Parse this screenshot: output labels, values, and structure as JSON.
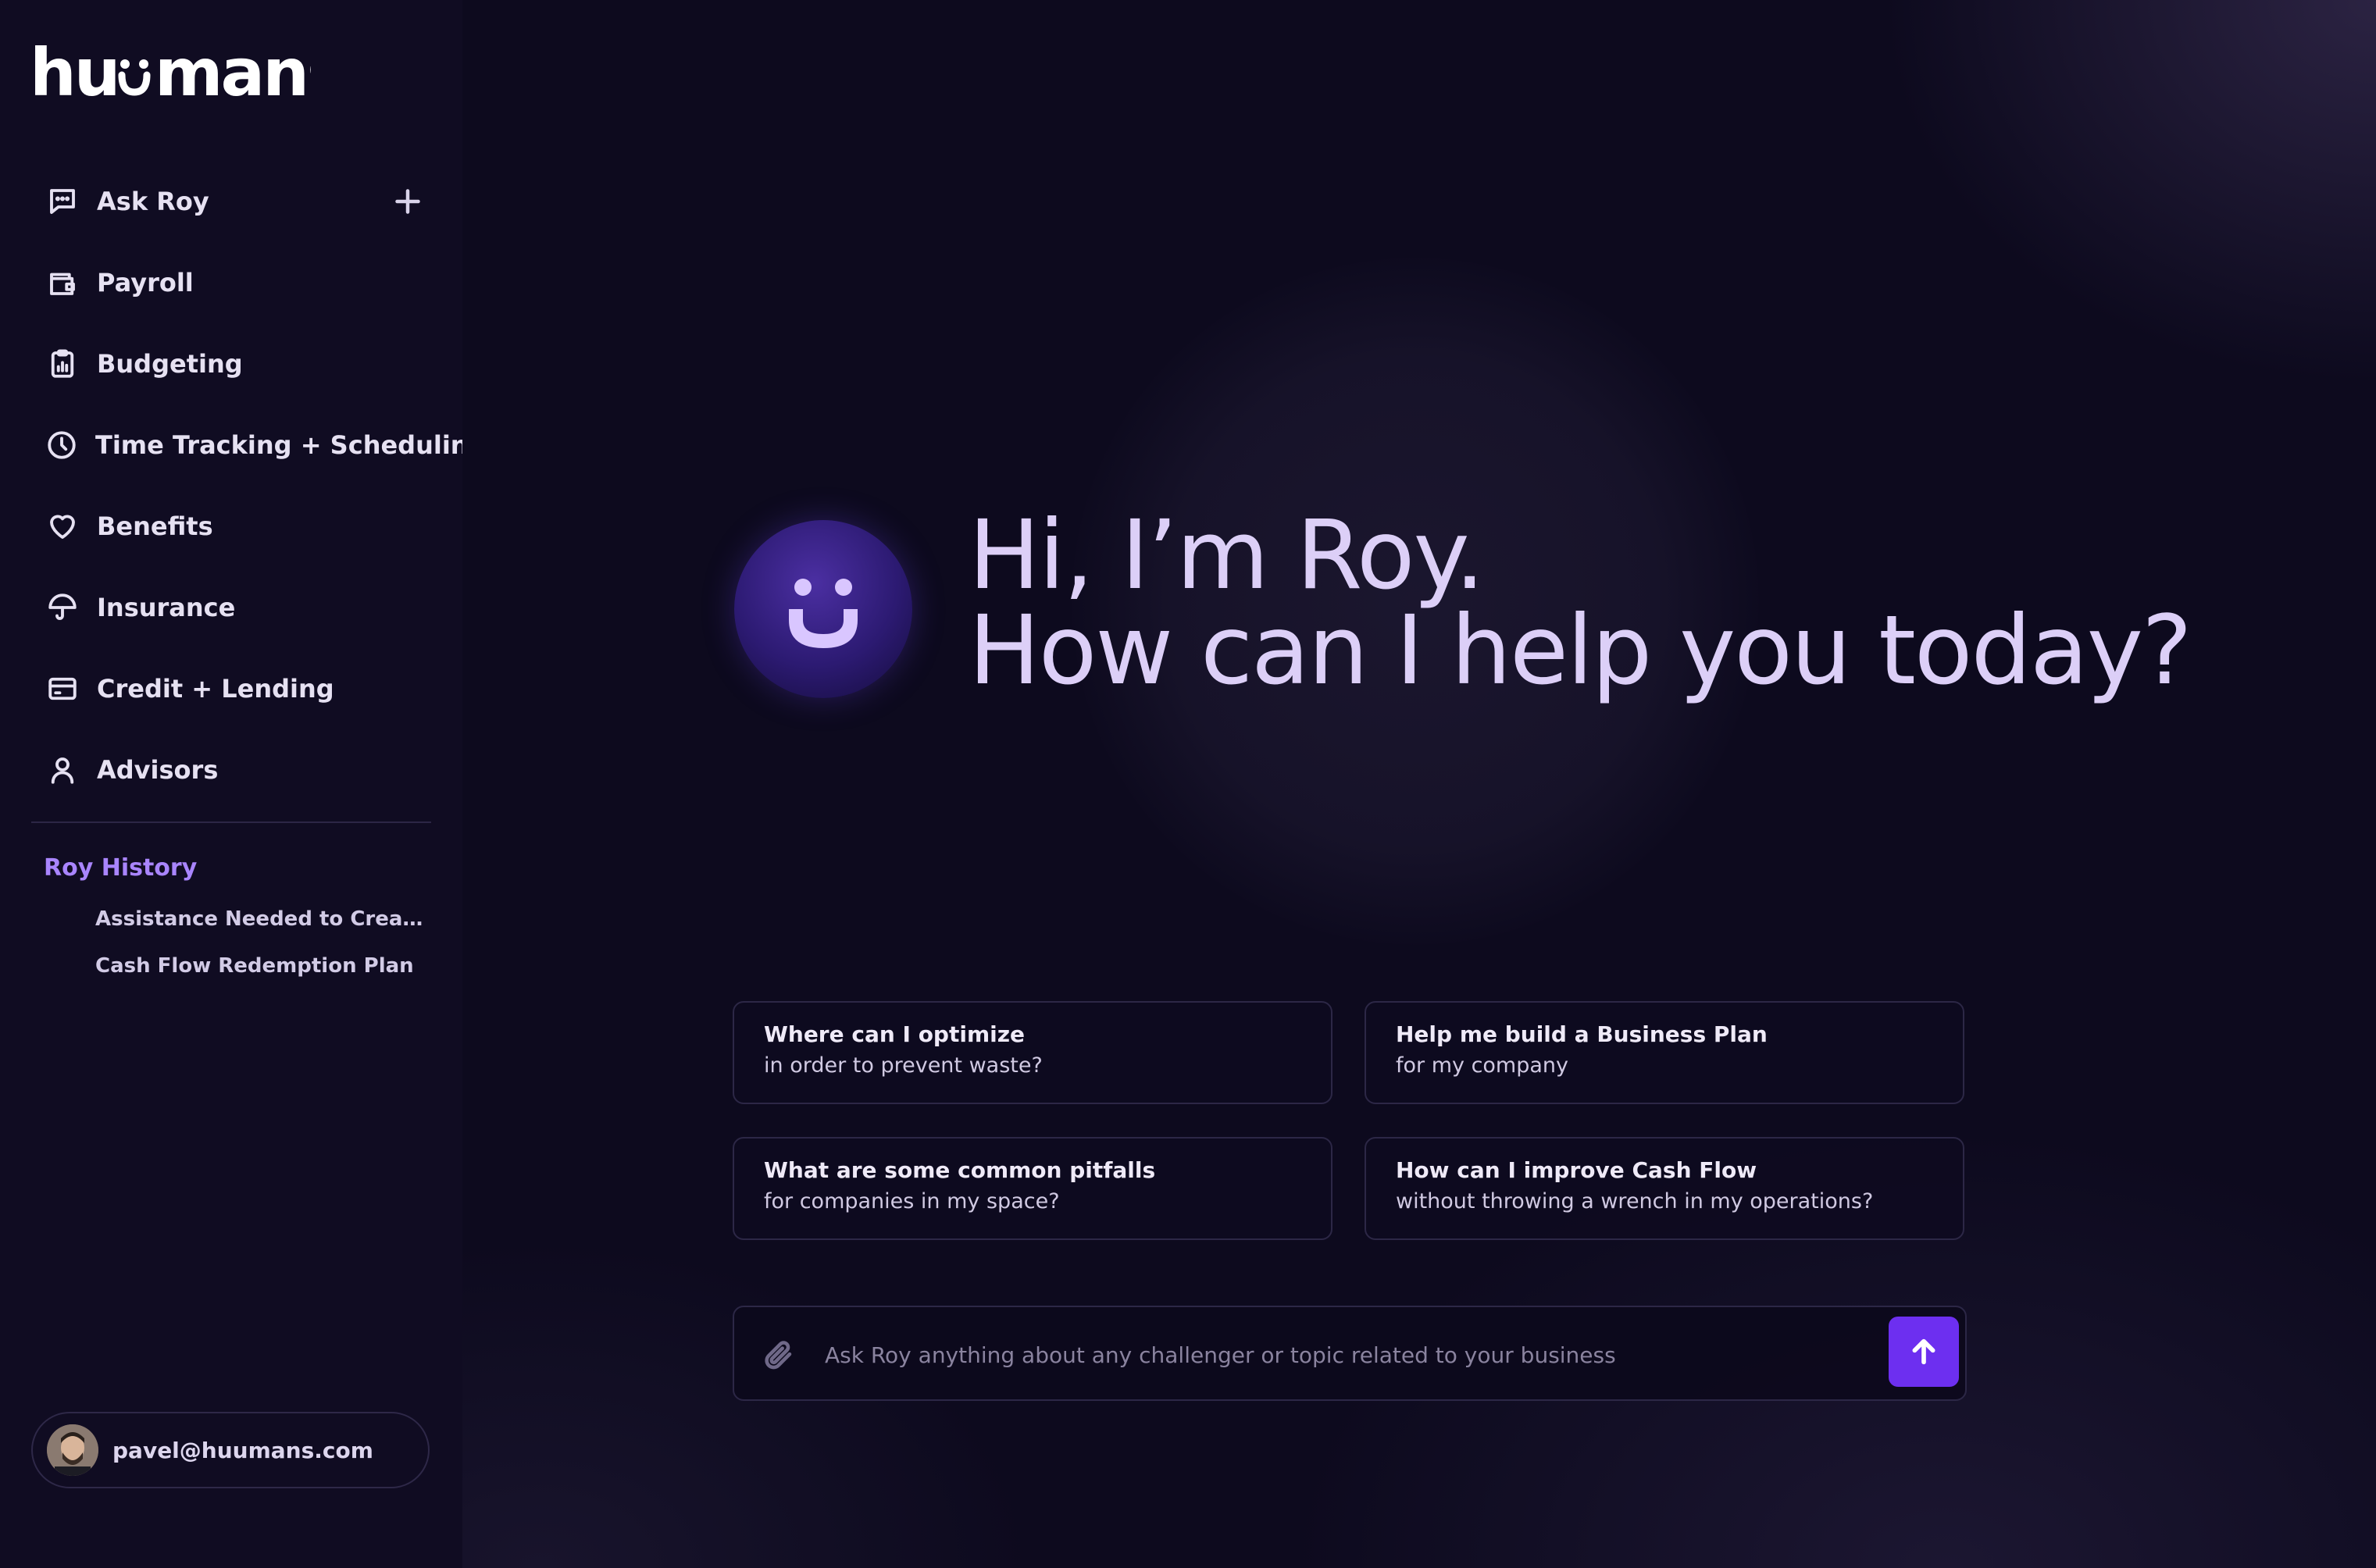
{
  "brand": {
    "logo_text": "huumans"
  },
  "sidebar": {
    "items": [
      {
        "label": "Ask Roy",
        "icon": "chat-icon"
      },
      {
        "label": "Payroll",
        "icon": "wallet-icon"
      },
      {
        "label": "Budgeting",
        "icon": "clipboard-chart-icon"
      },
      {
        "label": "Time Tracking + Scheduling",
        "icon": "clock-icon"
      },
      {
        "label": "Benefits",
        "icon": "heart-icon"
      },
      {
        "label": "Insurance",
        "icon": "umbrella-icon"
      },
      {
        "label": "Credit + Lending",
        "icon": "credit-card-icon"
      },
      {
        "label": "Advisors",
        "icon": "person-icon"
      }
    ],
    "history_title": "Roy History",
    "history": [
      "Assistance Needed to Create ...",
      "Cash Flow Redemption Plan"
    ]
  },
  "user": {
    "email": "pavel@huumans.com"
  },
  "hero": {
    "line1": "Hi, I’m Roy.",
    "line2": "How can I help you today?"
  },
  "suggestions": [
    {
      "title": "Where can I optimize",
      "subtitle": "in order to prevent waste?"
    },
    {
      "title": "Help me build a Business Plan",
      "subtitle": "for my company"
    },
    {
      "title": "What are some common pitfalls",
      "subtitle": "for companies in my space?"
    },
    {
      "title": "How can I improve Cash Flow",
      "subtitle": "without throwing a wrench in my operations?"
    }
  ],
  "composer": {
    "placeholder": "Ask Roy anything about any challenger or topic related to your business",
    "value": ""
  },
  "colors": {
    "accent": "#6d2ff0",
    "history_title": "#a985ff",
    "background": "#0d0a1e",
    "sidebar": "#100c22",
    "hero_text": "#dccff7"
  }
}
